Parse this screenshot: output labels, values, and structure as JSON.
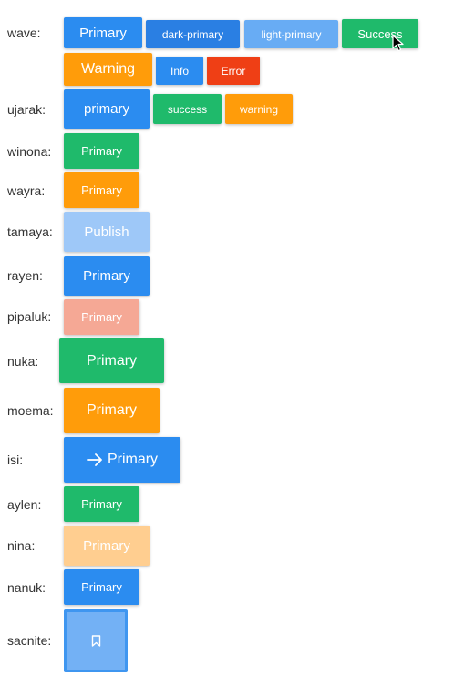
{
  "rows": {
    "wave": {
      "label": "wave:",
      "buttons": [
        "Primary",
        "dark-primary",
        "light-primary",
        "Success",
        "Warning",
        "Info",
        "Error"
      ]
    },
    "ujarak": {
      "label": "ujarak:",
      "buttons": [
        "primary",
        "success",
        "warning"
      ]
    },
    "winona": {
      "label": "winona:",
      "button": "Primary"
    },
    "wayra": {
      "label": "wayra:",
      "button": "Primary"
    },
    "tamaya": {
      "label": "tamaya:",
      "button": "Publish"
    },
    "rayen": {
      "label": "rayen:",
      "button": "Primary"
    },
    "pipaluk": {
      "label": "pipaluk:",
      "button": "Primary"
    },
    "nuka": {
      "label": "nuka:",
      "button": "Primary"
    },
    "moema": {
      "label": "moema:",
      "button": "Primary"
    },
    "isi": {
      "label": "isi:",
      "button": "Primary",
      "icon": "arrow-right-icon"
    },
    "aylen": {
      "label": "aylen:",
      "button": "Primary"
    },
    "nina": {
      "label": "nina:",
      "button": "Primary"
    },
    "nanuk": {
      "label": "nanuk:",
      "button": "Primary"
    },
    "sacnite": {
      "label": "sacnite:",
      "icon": "bookmark-icon"
    }
  },
  "colors": {
    "primary": "#2b8cf0",
    "dark_primary": "#2a7fe3",
    "light_primary": "#68acf4",
    "success": "#1fba6b",
    "warning": "#ff9c0a",
    "error": "#ef3f15"
  }
}
